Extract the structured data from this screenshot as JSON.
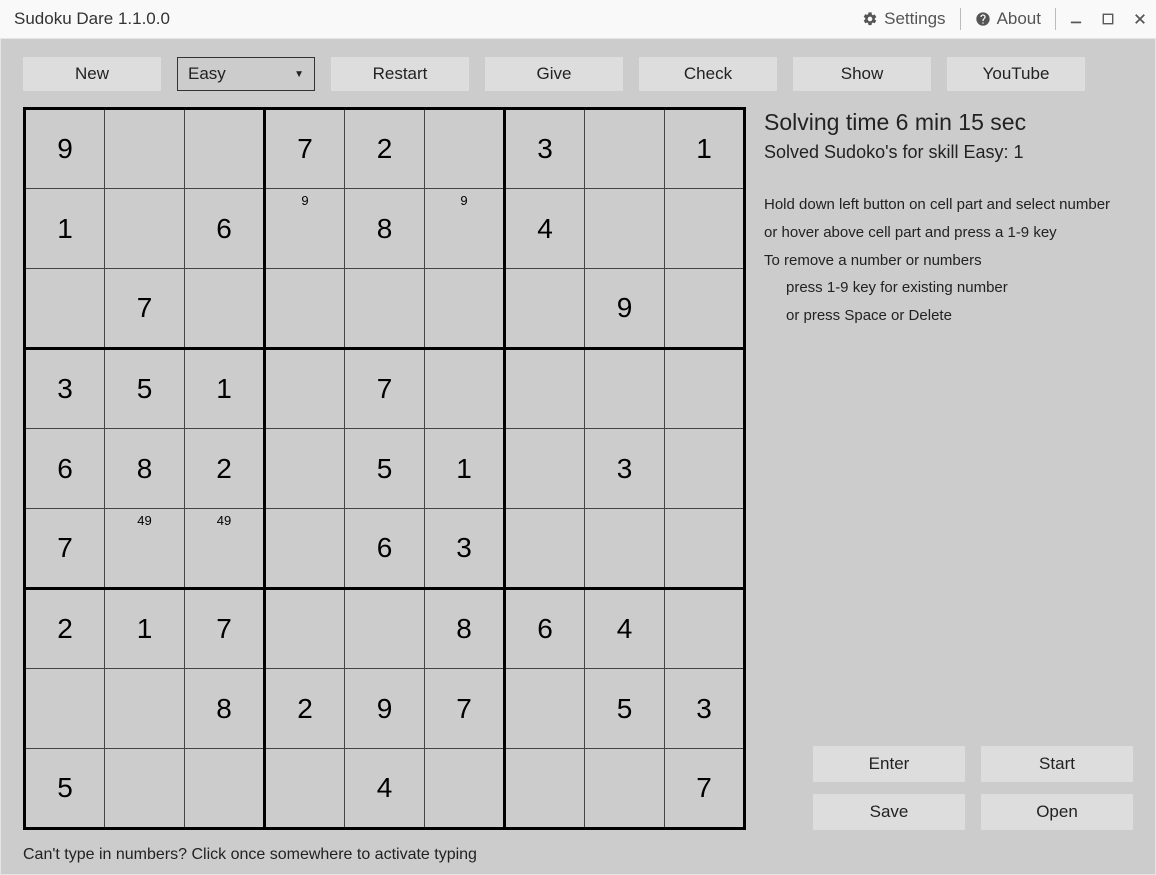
{
  "titlebar": {
    "title": "Sudoku Dare 1.1.0.0",
    "settings_label": "Settings",
    "about_label": "About"
  },
  "toolbar": {
    "new_label": "New",
    "difficulty_selected": "Easy",
    "restart_label": "Restart",
    "give_label": "Give",
    "check_label": "Check",
    "show_label": "Show",
    "youtube_label": "YouTube"
  },
  "board": {
    "rows": [
      [
        {
          "v": "9"
        },
        {
          "v": ""
        },
        {
          "v": ""
        },
        {
          "v": "7"
        },
        {
          "v": "2"
        },
        {
          "v": ""
        },
        {
          "v": "3"
        },
        {
          "v": ""
        },
        {
          "v": "1"
        }
      ],
      [
        {
          "v": "1"
        },
        {
          "v": ""
        },
        {
          "v": "6"
        },
        {
          "v": "",
          "c": "9"
        },
        {
          "v": "8"
        },
        {
          "v": "",
          "c": "9"
        },
        {
          "v": "4"
        },
        {
          "v": ""
        },
        {
          "v": ""
        }
      ],
      [
        {
          "v": ""
        },
        {
          "v": "7"
        },
        {
          "v": ""
        },
        {
          "v": ""
        },
        {
          "v": ""
        },
        {
          "v": ""
        },
        {
          "v": ""
        },
        {
          "v": "9"
        },
        {
          "v": ""
        }
      ],
      [
        {
          "v": "3"
        },
        {
          "v": "5"
        },
        {
          "v": "1"
        },
        {
          "v": ""
        },
        {
          "v": "7"
        },
        {
          "v": ""
        },
        {
          "v": ""
        },
        {
          "v": ""
        },
        {
          "v": ""
        }
      ],
      [
        {
          "v": "6"
        },
        {
          "v": "8"
        },
        {
          "v": "2"
        },
        {
          "v": ""
        },
        {
          "v": "5"
        },
        {
          "v": "1"
        },
        {
          "v": ""
        },
        {
          "v": "3"
        },
        {
          "v": ""
        }
      ],
      [
        {
          "v": "7"
        },
        {
          "v": "",
          "c": "49"
        },
        {
          "v": "",
          "c": "49"
        },
        {
          "v": ""
        },
        {
          "v": "6"
        },
        {
          "v": "3"
        },
        {
          "v": ""
        },
        {
          "v": ""
        },
        {
          "v": ""
        }
      ],
      [
        {
          "v": "2"
        },
        {
          "v": "1"
        },
        {
          "v": "7"
        },
        {
          "v": ""
        },
        {
          "v": ""
        },
        {
          "v": "8"
        },
        {
          "v": "6"
        },
        {
          "v": "4"
        },
        {
          "v": ""
        }
      ],
      [
        {
          "v": ""
        },
        {
          "v": ""
        },
        {
          "v": "8"
        },
        {
          "v": "2"
        },
        {
          "v": "9"
        },
        {
          "v": "7"
        },
        {
          "v": ""
        },
        {
          "v": "5"
        },
        {
          "v": "3"
        }
      ],
      [
        {
          "v": "5"
        },
        {
          "v": ""
        },
        {
          "v": ""
        },
        {
          "v": ""
        },
        {
          "v": "4"
        },
        {
          "v": ""
        },
        {
          "v": ""
        },
        {
          "v": ""
        },
        {
          "v": "7"
        }
      ]
    ]
  },
  "side": {
    "time_label": "Solving time 6 min 15 sec",
    "solved_label": "Solved Sudoko's for skill Easy: 1",
    "hint1": "Hold down left button on cell part and select number",
    "hint2": "or hover above cell part and press a 1-9 key",
    "hint3": "To remove a number or numbers",
    "hint4": "press 1-9 key for existing number",
    "hint5": "or press Space or Delete",
    "enter_label": "Enter",
    "start_label": "Start",
    "save_label": "Save",
    "open_label": "Open"
  },
  "footer": {
    "hint": "Can't type in numbers? Click once somewhere to activate typing"
  }
}
